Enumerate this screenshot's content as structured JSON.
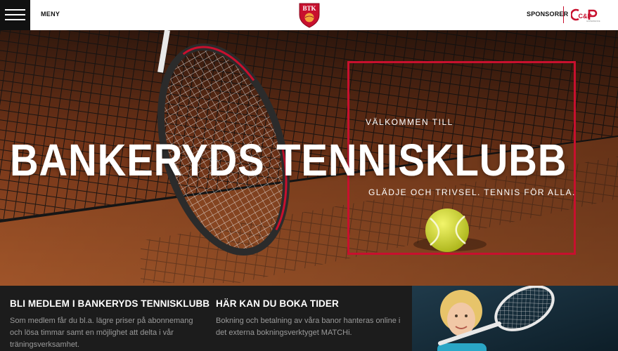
{
  "header": {
    "menu_label": "MENY",
    "logo_text": "BTK",
    "sponsor_label": "SPONSORER",
    "sponsor_logo_text": "C&P",
    "sponsor_logo_subtext": "EXPERIENCE"
  },
  "hero": {
    "kicker": "VÄLKOMMEN TILL",
    "title": "BANKERYDS TENNISKLUBB",
    "tagline": "GLÄDJE OCH TRIVSEL. TENNIS FÖR ALLA."
  },
  "cards": [
    {
      "title": "BLI MEDLEM I BANKERYDS TENNISKLUBB",
      "text": "Som medlem får du bl.a. lägre priser på abonnemang och lösa timmar samt en möjlighet att delta i vår träningsverksamhet."
    },
    {
      "title": "HÄR KAN DU BOKA TIDER",
      "text": "Bokning och betalning av våra banor hanteras online i det externa bokningsverktyget MATCHi."
    }
  ],
  "colors": {
    "accent": "#c8102e",
    "clay": "#b4552b",
    "dark": "#1c1c1c"
  }
}
